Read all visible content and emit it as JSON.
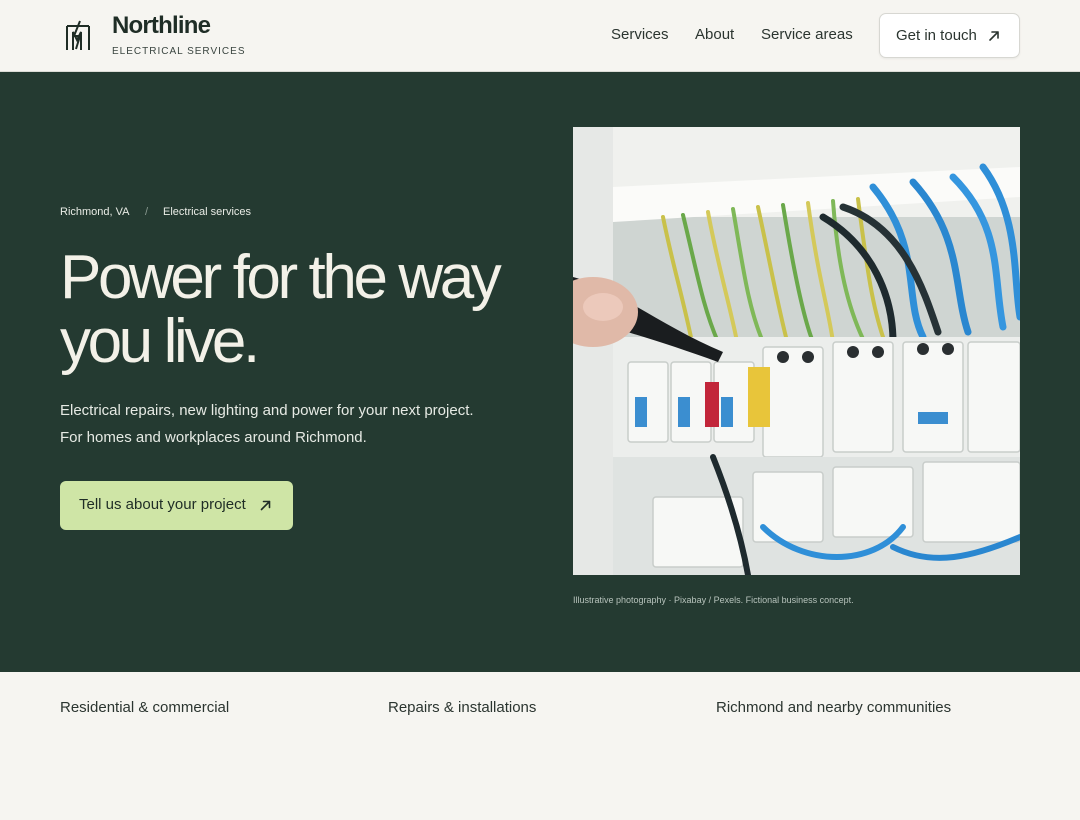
{
  "brand": {
    "name": "Northline",
    "subtitle": "ELECTRICAL SERVICES",
    "logo_icon": "lightning-panel-icon"
  },
  "nav": {
    "items": [
      {
        "label": "Services"
      },
      {
        "label": "About"
      },
      {
        "label": "Service areas"
      }
    ],
    "cta_label": "Get in touch",
    "cta_icon": "arrow-up-right-icon"
  },
  "hero": {
    "breadcrumb": [
      "Richmond, VA",
      "/",
      "Electrical services"
    ],
    "title": "Power for the way you live.",
    "description": "Electrical repairs, new lighting and power for your next project. For homes and workplaces around Richmond.",
    "button_label": "Tell us about your project",
    "button_icon": "arrow-up-right-icon",
    "photo_caption": "Illustrative photography · Pixabay / Pexels. Fictional business concept."
  },
  "features": [
    {
      "label": "Residential & commercial"
    },
    {
      "label": "Repairs & installations"
    },
    {
      "label": "Richmond and nearby communities"
    }
  ],
  "colors": {
    "hero_bg": "#243a31",
    "accent": "#cfe5a6",
    "page_bg": "#f6f5f1",
    "text_dark": "#1f2d26"
  }
}
